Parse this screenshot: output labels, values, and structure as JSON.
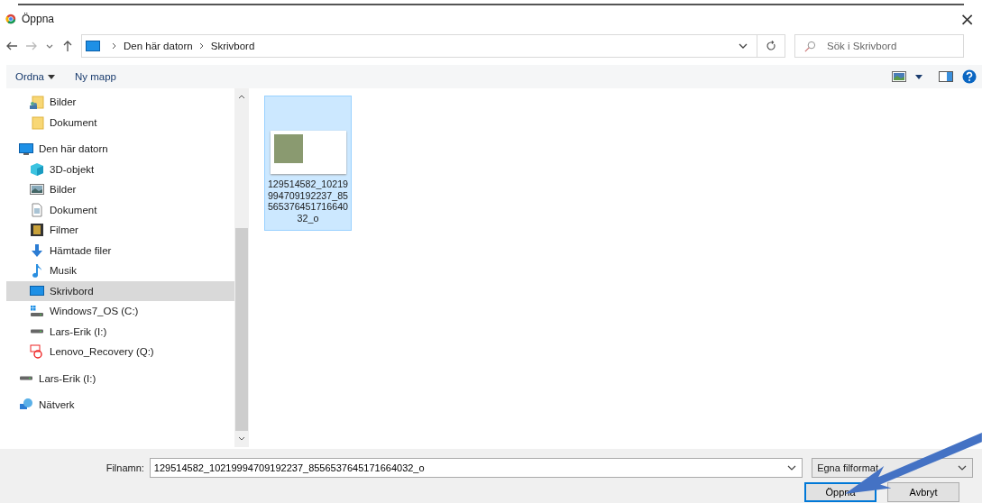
{
  "window": {
    "title": "Öppna",
    "close": "×"
  },
  "address": {
    "path": [
      "Den här datorn",
      "Skrivbord"
    ]
  },
  "search": {
    "placeholder": "Sök i Skrivbord"
  },
  "toolbar": {
    "buttons": [
      "Ordna",
      "Ny mapp"
    ]
  },
  "sidebar": {
    "items": [
      {
        "children": [
          {
            "label": "Bilder",
            "kind": "shared-folder",
            "selected": false
          },
          {
            "label": "Dokument",
            "kind": "folder",
            "selected": false
          }
        ]
      },
      {
        "label": "Den här datorn",
        "kind": "computer",
        "selected": false,
        "children": [
          {
            "label": "3D-objekt",
            "kind": "cube",
            "selected": false
          },
          {
            "label": "Bilder",
            "kind": "pictures",
            "selected": false
          },
          {
            "label": "Dokument",
            "kind": "document",
            "selected": false
          },
          {
            "label": "Filmer",
            "kind": "film",
            "selected": false
          },
          {
            "label": "Hämtade filer",
            "kind": "download",
            "selected": false
          },
          {
            "label": "Musik",
            "kind": "music",
            "selected": false
          },
          {
            "label": "Skrivbord",
            "kind": "desktop",
            "selected": true
          },
          {
            "label": "Windows7_OS (C:)",
            "kind": "windows-drive",
            "selected": false
          },
          {
            "label": "Lars-Erik (I:)",
            "kind": "drive",
            "selected": false
          },
          {
            "label": "Lenovo_Recovery (Q:)",
            "kind": "recovery",
            "selected": false
          }
        ]
      },
      {
        "label": "Lars-Erik (I:)",
        "kind": "drive",
        "selected": false
      },
      {
        "label": "Nätverk",
        "kind": "network",
        "selected": false
      }
    ]
  },
  "files": [
    {
      "name": "129514582_10219994709192237_8556537645171664032_o",
      "selected": true
    }
  ],
  "footer": {
    "filename_label": "Filnamn:",
    "filename": "129514582_10219994709192237_8556537645171664032_o",
    "filetype": "Egna filformat",
    "buttons": [
      "Öppna",
      "Avbryt"
    ]
  }
}
